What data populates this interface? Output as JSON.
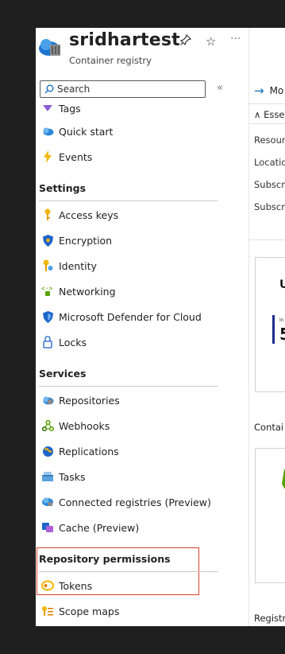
{
  "header": {
    "title": "sridhartest",
    "subtitle": "Container registry",
    "icons": [
      "container-registry-icon",
      "pin-icon",
      "star-icon",
      "more-icon"
    ],
    "pin_glyph": "✎",
    "star_glyph": "☆",
    "more_glyph": "···"
  },
  "search": {
    "placeholder": "Search",
    "collapse_glyph": "«"
  },
  "nav": {
    "top_items": [
      {
        "label": "Tags",
        "icon": "tag-icon"
      },
      {
        "label": "Quick start",
        "icon": "cloud-icon"
      },
      {
        "label": "Events",
        "icon": "lightning-icon"
      }
    ],
    "sections": [
      {
        "title": "Settings",
        "items": [
          {
            "label": "Access keys",
            "icon": "key-icon"
          },
          {
            "label": "Encryption",
            "icon": "shield-icon"
          },
          {
            "label": "Identity",
            "icon": "identity-key-icon"
          },
          {
            "label": "Networking",
            "icon": "networking-icon"
          },
          {
            "label": "Microsoft Defender for Cloud",
            "icon": "defender-shield-icon"
          },
          {
            "label": "Locks",
            "icon": "lock-icon"
          }
        ]
      },
      {
        "title": "Services",
        "items": [
          {
            "label": "Repositories",
            "icon": "repositories-cloud-icon"
          },
          {
            "label": "Webhooks",
            "icon": "webhook-icon"
          },
          {
            "label": "Replications",
            "icon": "globe-icon"
          },
          {
            "label": "Tasks",
            "icon": "tasks-icon"
          },
          {
            "label": "Connected registries (Preview)",
            "icon": "connected-registry-icon"
          },
          {
            "label": "Cache (Preview)",
            "icon": "cache-icon"
          }
        ]
      },
      {
        "title": "Repository permissions",
        "items": [
          {
            "label": "Tokens",
            "icon": "token-icon"
          },
          {
            "label": "Scope maps",
            "icon": "scope-map-icon"
          }
        ]
      }
    ]
  },
  "right_panel": {
    "move_label": "Mo",
    "essentials_label": "Esse",
    "fields": [
      "Resour",
      "Locatio",
      "Subscri",
      "Subscri"
    ],
    "card_title": "U",
    "card_small": "In",
    "card_value": "5",
    "section_label": "Contai",
    "bottom_label": "Registr"
  },
  "colors": {
    "accent": "#0f6cbd",
    "highlight_border": "#d9452b",
    "key_yellow": "#f2b705",
    "shield_blue": "#1e65c9",
    "defender_green": "#57a300"
  }
}
